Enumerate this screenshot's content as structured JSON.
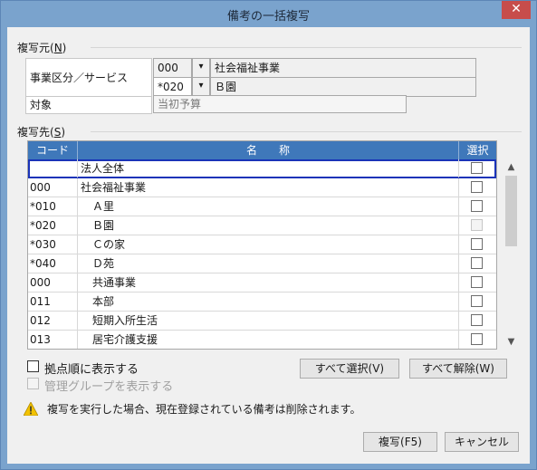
{
  "window": {
    "title": "備考の一括複写",
    "close_label": "✕"
  },
  "source": {
    "heading": "複写元(",
    "heading_key": "N",
    "heading_tail": ")",
    "division_label": "事業区分／サービス",
    "division_code": "000",
    "division_name": "社会福祉事業",
    "service_code": "*020",
    "service_name": "Ｂ園",
    "target_label": "対象",
    "target_value": "当初予算",
    "dropdown_icon": "▾"
  },
  "dest": {
    "heading": "複写先(",
    "heading_key": "S",
    "heading_tail": ")",
    "columns": {
      "code": "コード",
      "name": "名　　称",
      "select": "選択"
    },
    "rows": [
      {
        "code": "",
        "name": "法人全体",
        "indent": false,
        "disabled": false
      },
      {
        "code": "000",
        "name": "社会福祉事業",
        "indent": false,
        "disabled": false
      },
      {
        "code": "*010",
        "name": "Ａ里",
        "indent": true,
        "disabled": false
      },
      {
        "code": "*020",
        "name": "Ｂ園",
        "indent": true,
        "disabled": true
      },
      {
        "code": "*030",
        "name": "Ｃの家",
        "indent": true,
        "disabled": false
      },
      {
        "code": "*040",
        "name": "Ｄ苑",
        "indent": true,
        "disabled": false
      },
      {
        "code": "000",
        "name": "共通事業",
        "indent": true,
        "disabled": false
      },
      {
        "code": "011",
        "name": "本部",
        "indent": true,
        "disabled": false
      },
      {
        "code": "012",
        "name": "短期入所生活",
        "indent": true,
        "disabled": false
      },
      {
        "code": "013",
        "name": "居宅介護支援",
        "indent": true,
        "disabled": false
      }
    ]
  },
  "options": {
    "sort_by_base": "拠点順に表示する",
    "show_mgmt_group": "管理グループを表示する"
  },
  "buttons": {
    "select_all": "すべて選択(V)",
    "clear_all": "すべて解除(W)",
    "copy": "複写(F5)",
    "cancel": "キャンセル"
  },
  "warning": "複写を実行した場合、現在登録されている備考は削除されます。",
  "colors": {
    "titlebar": "#7aa3cd",
    "header": "#3f78ba",
    "close": "#c74d4b",
    "selection": "#1a33b8"
  }
}
